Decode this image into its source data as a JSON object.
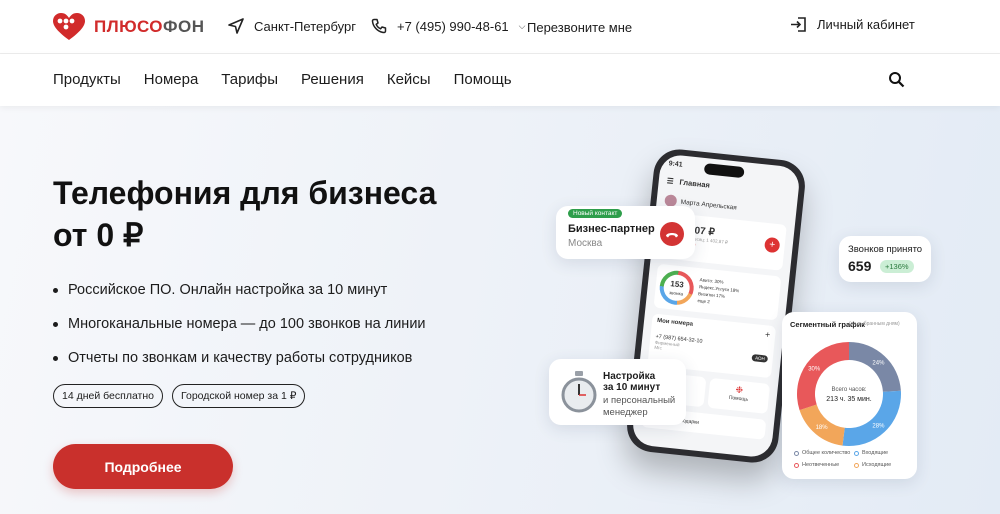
{
  "header": {
    "brand": {
      "a": "ПЛЮСО",
      "b": "ФОН"
    },
    "city": "Санкт-Петербург",
    "phone": "+7 (495) 990-48-61",
    "callback": "Перезвоните мне",
    "cabinet": "Личный кабинет"
  },
  "nav": [
    "Продукты",
    "Номера",
    "Тарифы",
    "Решения",
    "Кейсы",
    "Помощь"
  ],
  "hero": {
    "title_line1": "Телефония для бизнеса",
    "title_line2": "от 0 ₽",
    "bullets": [
      "Российское ПО. Онлайн настройка за 10 минут",
      "Многоканальные номера — до 100 звонков на линии",
      "Отчеты по звонкам и качеству работы сотрудников"
    ],
    "tags": [
      "14 дней бесплатно",
      "Городской номер за 1 ₽"
    ],
    "cta": "Подробнее"
  },
  "widgets": {
    "contact": {
      "pill": "Новый контакт",
      "title": "Бизнес-партнер",
      "city": "Москва"
    },
    "calls": {
      "title": "Звонков принято",
      "value": "659",
      "badge": "+136%"
    },
    "setup": {
      "title1": "Настройка",
      "title2": "за 10 минут",
      "sub1": "и персональный",
      "sub2": "менеджер"
    },
    "chart": {
      "title": "Сегментный график",
      "subtitle": "(по выбранным дням)",
      "center_label": "Всего часов:",
      "center_value": "213 ч. 35 мин.",
      "legend": [
        "Общее количество",
        "Входящие",
        "Неотвеченные",
        "Исходящие"
      ]
    }
  },
  "phone_screen": {
    "time": "9:41",
    "screen_title": "Главная",
    "user": "Марта Апрельская",
    "balance_label": "Баланс",
    "balance": "1 232,07 ₽",
    "balance_note": "Расходы за месяц: 1 402,87 ₽",
    "details": "Детализация",
    "ring_value": "153",
    "ring_label": "звонка",
    "stats": [
      "Авито: 30%",
      "Яндекс.Услуги 18%",
      "Визитки 17%",
      "еще 2"
    ],
    "numbers_title": "Мои номера",
    "number": "+7 (987) 654-32-10",
    "number_sub": "Фирменный",
    "number_tag": "Мгс",
    "aon": "АОН",
    "tiles": [
      "Услуги",
      "Помощь"
    ],
    "promo": "Акции и подарки"
  },
  "chart_data": {
    "type": "pie",
    "title": "Сегментный график",
    "center": "213 ч. 35 мин.",
    "categories": [
      "Общее количество",
      "Входящие",
      "Исходящие",
      "Неотвеченные"
    ],
    "values": [
      24,
      28,
      18,
      30
    ],
    "labels": [
      "24%",
      "28%",
      "18%",
      "30%"
    ],
    "colors": [
      "#7a88a6",
      "#5aa6e8",
      "#f2a65a",
      "#e8585a"
    ]
  }
}
